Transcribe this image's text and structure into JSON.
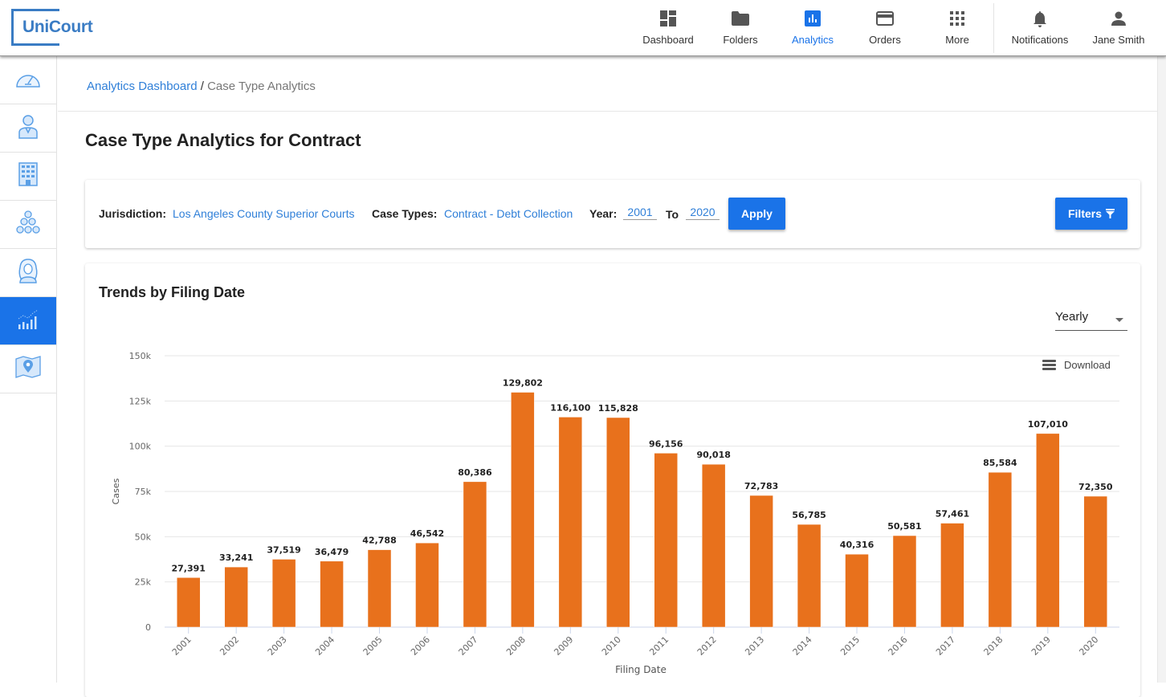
{
  "header": {
    "logo_text": "UniCourt",
    "nav": [
      {
        "label": "Dashboard",
        "icon": "dashboard-icon"
      },
      {
        "label": "Folders",
        "icon": "folder-icon"
      },
      {
        "label": "Analytics",
        "icon": "analytics-icon",
        "active": true
      },
      {
        "label": "Orders",
        "icon": "orders-icon"
      },
      {
        "label": "More",
        "icon": "apps-grid-icon"
      }
    ],
    "notifications_label": "Notifications",
    "user_label": "Jane Smith"
  },
  "sidebar": {
    "items": [
      {
        "name": "speedometer-icon"
      },
      {
        "name": "attorney-icon"
      },
      {
        "name": "building-icon"
      },
      {
        "name": "people-network-icon"
      },
      {
        "name": "judge-icon"
      },
      {
        "name": "analytics-trend-icon",
        "active": true
      },
      {
        "name": "map-pin-icon"
      }
    ]
  },
  "breadcrumb": {
    "parent": "Analytics Dashboard",
    "separator": "/",
    "current": "Case Type Analytics"
  },
  "page_title": "Case Type Analytics for Contract",
  "filters": {
    "jurisdiction_label": "Jurisdiction:",
    "jurisdiction_value": "Los Angeles County Superior Courts",
    "case_types_label": "Case Types:",
    "case_types_value": "Contract - Debt Collection",
    "year_label": "Year:",
    "year_from": "2001",
    "to_label": "To",
    "year_to": "2020",
    "apply_label": "Apply",
    "filters_label": "Filters"
  },
  "chart_card": {
    "title": "Trends by Filing Date",
    "granularity": "Yearly",
    "download_label": "Download"
  },
  "colors": {
    "accent": "#1a73e8",
    "bar": "#e8711c",
    "link": "#2f7fd8"
  },
  "chart_data": {
    "type": "bar",
    "title": "Trends by Filing Date",
    "xlabel": "Filing Date",
    "ylabel": "Cases",
    "ylim": [
      0,
      150000
    ],
    "yticks": [
      0,
      25000,
      50000,
      75000,
      100000,
      125000,
      150000
    ],
    "ytick_labels": [
      "0",
      "25k",
      "50k",
      "75k",
      "100k",
      "125k",
      "150k"
    ],
    "grid": true,
    "legend": "none",
    "categories": [
      "2001",
      "2002",
      "2003",
      "2004",
      "2005",
      "2006",
      "2007",
      "2008",
      "2009",
      "2010",
      "2011",
      "2012",
      "2013",
      "2014",
      "2015",
      "2016",
      "2017",
      "2018",
      "2019",
      "2020"
    ],
    "values": [
      27391,
      33241,
      37519,
      36479,
      42788,
      46542,
      80386,
      129802,
      116100,
      115828,
      96156,
      90018,
      72783,
      56785,
      40316,
      50581,
      57461,
      85584,
      107010,
      72350
    ],
    "data_labels": [
      "27,391",
      "33,241",
      "37,519",
      "36,479",
      "42,788",
      "46,542",
      "80,386",
      "129,802",
      "116,100",
      "115,828",
      "96,156",
      "90,018",
      "72,783",
      "56,785",
      "40,316",
      "50,581",
      "57,461",
      "85,584",
      "107,010",
      "72,350"
    ]
  }
}
